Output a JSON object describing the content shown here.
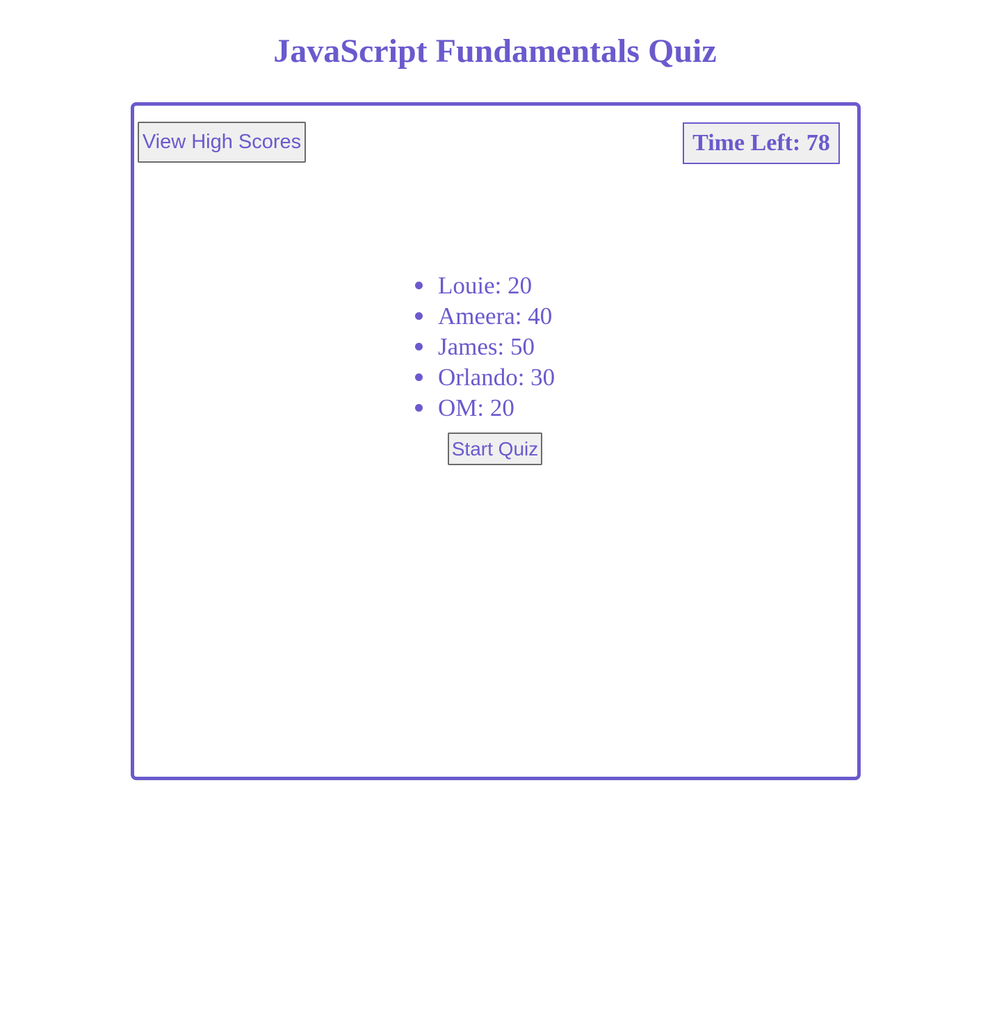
{
  "header": {
    "title": "JavaScript Fundamentals Quiz"
  },
  "controls": {
    "high_scores_label": "View High Scores",
    "timer_text": "Time Left: 78",
    "start_label": "Start Quiz"
  },
  "scores": [
    {
      "text": "Louie: 20"
    },
    {
      "text": "Ameera: 40"
    },
    {
      "text": "James: 50"
    },
    {
      "text": "Orlando: 30"
    },
    {
      "text": "OM: 20"
    }
  ],
  "colors": {
    "accent": "#6a5acd",
    "button_background": "#efefef",
    "button_border": "#6b6b6b"
  }
}
